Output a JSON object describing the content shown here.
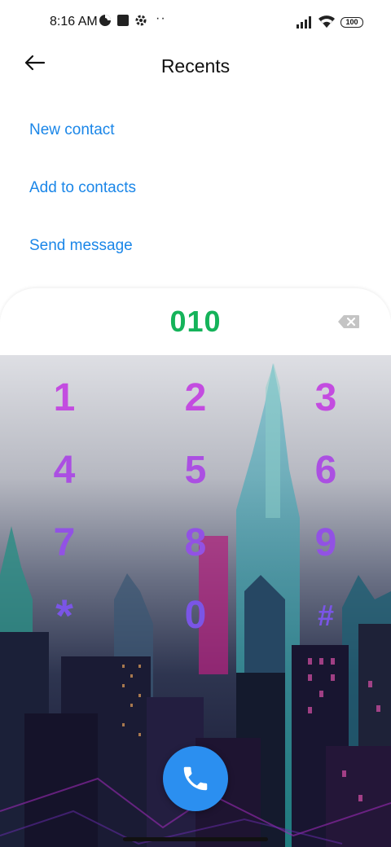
{
  "status_bar": {
    "time": "8:16 AM",
    "dots": "··",
    "battery": "100",
    "icons": [
      "data-saver-icon",
      "square-notification-icon",
      "settings-gear-icon",
      "signal-icon",
      "wifi-icon",
      "battery-icon"
    ]
  },
  "header": {
    "title": "Recents",
    "back_icon": "arrow-left-icon"
  },
  "actions": {
    "new_contact": "New contact",
    "add_to_contacts": "Add to contacts",
    "send_message": "Send message"
  },
  "dialer": {
    "number": "010",
    "keys": [
      "1",
      "2",
      "3",
      "4",
      "5",
      "6",
      "7",
      "8",
      "9",
      "*",
      "0",
      "#"
    ],
    "backspace_icon": "backspace-icon",
    "call_icon": "phone-icon"
  },
  "colors": {
    "accent": "#1a86e8",
    "number": "#15b35a",
    "call_button": "#2b8ff0",
    "key_top": "#c34ce0",
    "key_bottom": "#7a55e6"
  }
}
